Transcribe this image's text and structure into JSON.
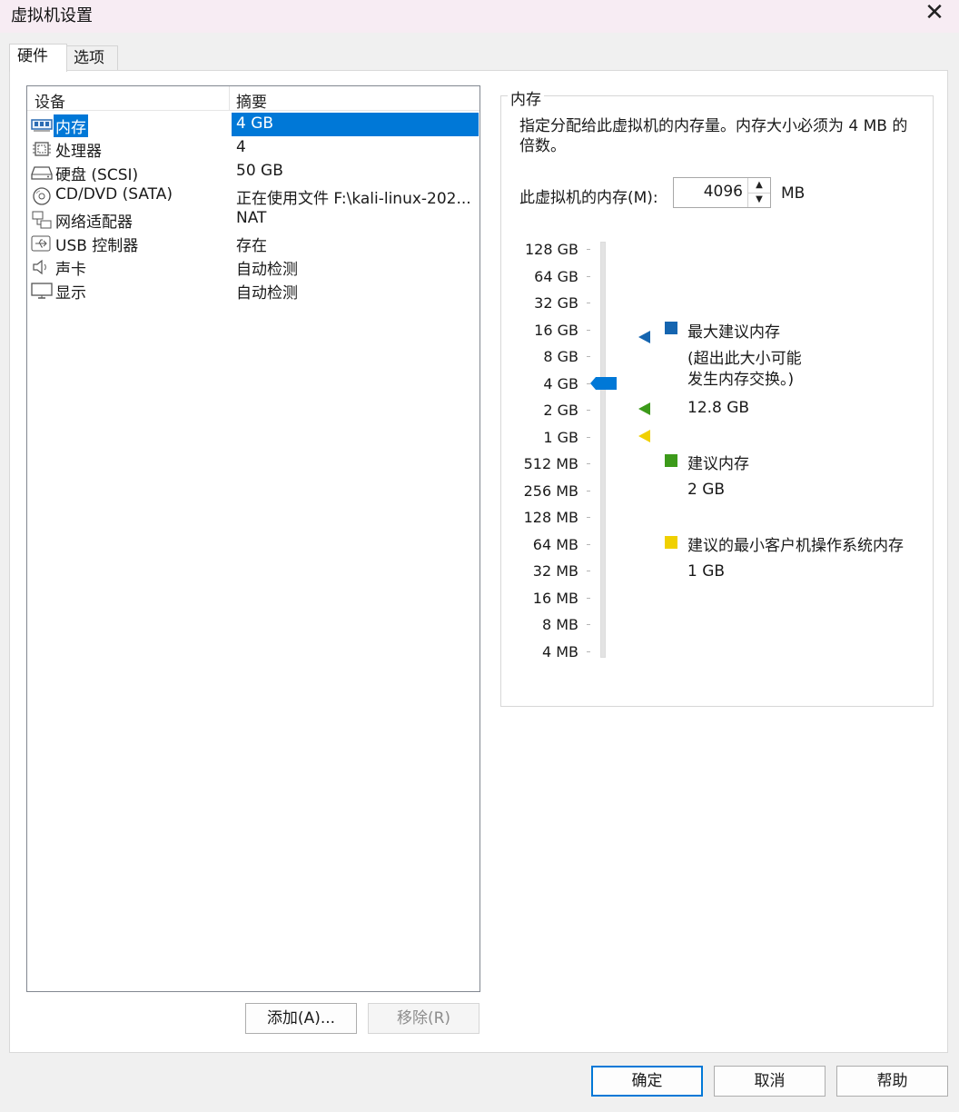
{
  "window": {
    "title": "虚拟机设置",
    "close_glyph": "✕"
  },
  "tabs": [
    {
      "label": "硬件",
      "active": true
    },
    {
      "label": "选项",
      "active": false
    }
  ],
  "device_list": {
    "columns": [
      "设备",
      "摘要"
    ],
    "rows": [
      {
        "name": "内存",
        "summary": "4 GB",
        "icon": "memory-icon",
        "selected": true
      },
      {
        "name": "处理器",
        "summary": "4",
        "icon": "processor-icon"
      },
      {
        "name": "硬盘 (SCSI)",
        "summary": "50 GB",
        "icon": "hard-disk-icon"
      },
      {
        "name": "CD/DVD (SATA)",
        "summary": "正在使用文件 F:\\kali-linux-202...",
        "icon": "cd-dvd-icon"
      },
      {
        "name": "网络适配器",
        "summary": "NAT",
        "icon": "network-adapter-icon"
      },
      {
        "name": "USB 控制器",
        "summary": "存在",
        "icon": "usb-icon"
      },
      {
        "name": "声卡",
        "summary": "自动检测",
        "icon": "speaker-icon"
      },
      {
        "name": "显示",
        "summary": "自动检测",
        "icon": "monitor-icon"
      }
    ]
  },
  "list_buttons": {
    "add": "添加(A)...",
    "remove": "移除(R)"
  },
  "memory": {
    "group_title": "内存",
    "description": "指定分配给此虚拟机的内存量。内存大小必须为 4 MB 的倍数。",
    "field_label": "此虚拟机的内存(M):",
    "value": "4096",
    "unit": "MB",
    "scale_labels": [
      "128 GB",
      "64 GB",
      "32 GB",
      "16 GB",
      "8 GB",
      "4 GB",
      "2 GB",
      "1 GB",
      "512 MB",
      "256 MB",
      "128 MB",
      "64 MB",
      "32 MB",
      "16 MB",
      "8 MB",
      "4 MB"
    ],
    "slider_value": "4 GB",
    "legend": {
      "max_recommended": {
        "label": "最大建议内存",
        "note": "(超出此大小可能\n发生内存交换。)",
        "value": "12.8 GB",
        "color": "#1565b0"
      },
      "recommended": {
        "label": "建议内存",
        "value": "2 GB",
        "color": "#3c9a1a"
      },
      "min_guest": {
        "label": "建议的最小客户机操作系统内存",
        "value": "1 GB",
        "color": "#f0d000"
      }
    }
  },
  "footer": {
    "ok": "确定",
    "cancel": "取消",
    "help": "帮助"
  },
  "colors": {
    "selection": "#0078d7",
    "slider_thumb": "#0078d7"
  }
}
